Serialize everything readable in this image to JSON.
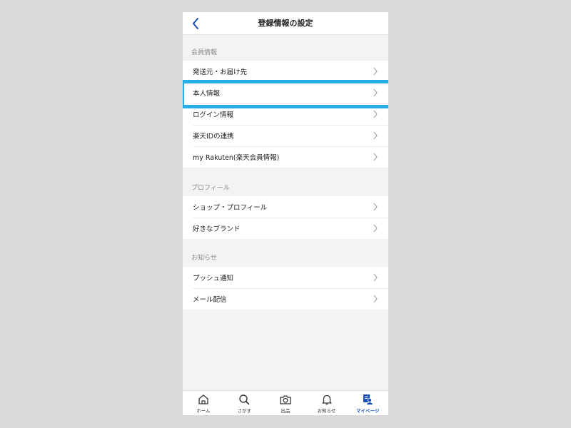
{
  "header": {
    "title": "登録情報の設定"
  },
  "sections": [
    {
      "label": "会員情報",
      "items": [
        {
          "label": "発送元・お届け先"
        },
        {
          "label": "本人情報"
        },
        {
          "label": "ログイン情報"
        },
        {
          "label": "楽天IDの連携"
        },
        {
          "label": "my Rakuten(楽天会員情報)"
        }
      ]
    },
    {
      "label": "プロフィール",
      "items": [
        {
          "label": "ショップ・プロフィール"
        },
        {
          "label": "好きなブランド"
        }
      ]
    },
    {
      "label": "お知らせ",
      "items": [
        {
          "label": "プッシュ通知"
        },
        {
          "label": "メール配信"
        }
      ]
    }
  ],
  "tabbar": {
    "items": [
      {
        "label": "ホーム",
        "icon": "home-icon"
      },
      {
        "label": "さがす",
        "icon": "search-icon"
      },
      {
        "label": "出品",
        "icon": "camera-icon"
      },
      {
        "label": "お知らせ",
        "icon": "bell-icon"
      },
      {
        "label": "マイページ",
        "icon": "mypage-icon",
        "active": true
      }
    ]
  },
  "colors": {
    "accent": "#1a4fb8",
    "highlight": "#25aee8",
    "background": "#f3f3f3"
  }
}
